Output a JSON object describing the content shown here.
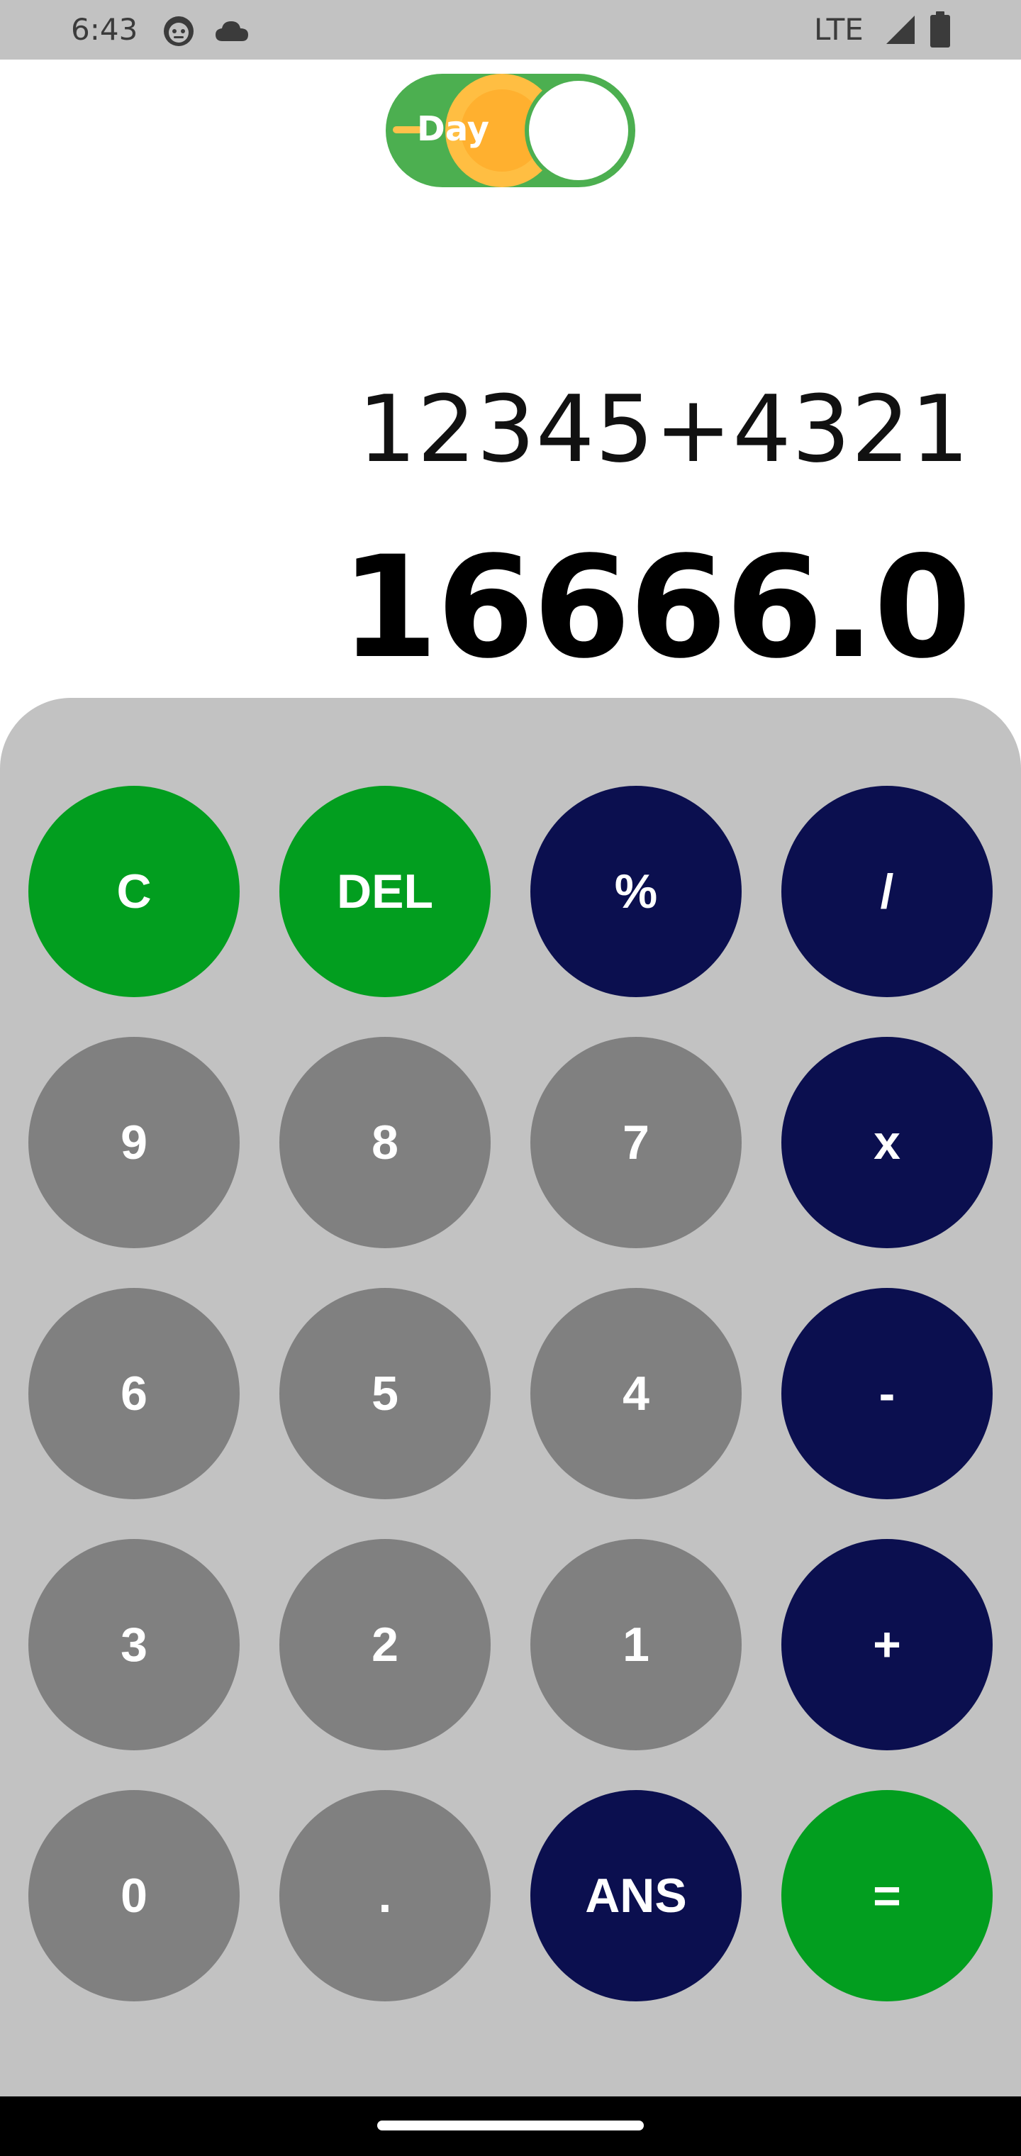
{
  "status_bar": {
    "time": "6:43",
    "network": "LTE",
    "icons": [
      "robot-face-icon",
      "cloud-icon",
      "signal-icon",
      "battery-icon"
    ]
  },
  "theme_toggle": {
    "label": "Day",
    "state": "day",
    "colors": {
      "track": "#4caf50",
      "sun": "#ffb02f",
      "knob": "#ffffff"
    }
  },
  "display": {
    "expression": "12345+4321",
    "result": "16666.0"
  },
  "keypad": {
    "colors": {
      "green": "#029e1f",
      "navy": "#0b0f4f",
      "gray": "#808080",
      "panel": "#c2c2c2"
    },
    "keys": [
      {
        "label": "C",
        "style": "green"
      },
      {
        "label": "DEL",
        "style": "green"
      },
      {
        "label": "%",
        "style": "navy"
      },
      {
        "label": "/",
        "style": "navy"
      },
      {
        "label": "9",
        "style": "gray"
      },
      {
        "label": "8",
        "style": "gray"
      },
      {
        "label": "7",
        "style": "gray"
      },
      {
        "label": "x",
        "style": "navy"
      },
      {
        "label": "6",
        "style": "gray"
      },
      {
        "label": "5",
        "style": "gray"
      },
      {
        "label": "4",
        "style": "gray"
      },
      {
        "label": "-",
        "style": "navy"
      },
      {
        "label": "3",
        "style": "gray"
      },
      {
        "label": "2",
        "style": "gray"
      },
      {
        "label": "1",
        "style": "gray"
      },
      {
        "label": "+",
        "style": "navy"
      },
      {
        "label": "0",
        "style": "gray"
      },
      {
        "label": ".",
        "style": "gray"
      },
      {
        "label": "ANS",
        "style": "navy"
      },
      {
        "label": "=",
        "style": "green"
      }
    ]
  }
}
